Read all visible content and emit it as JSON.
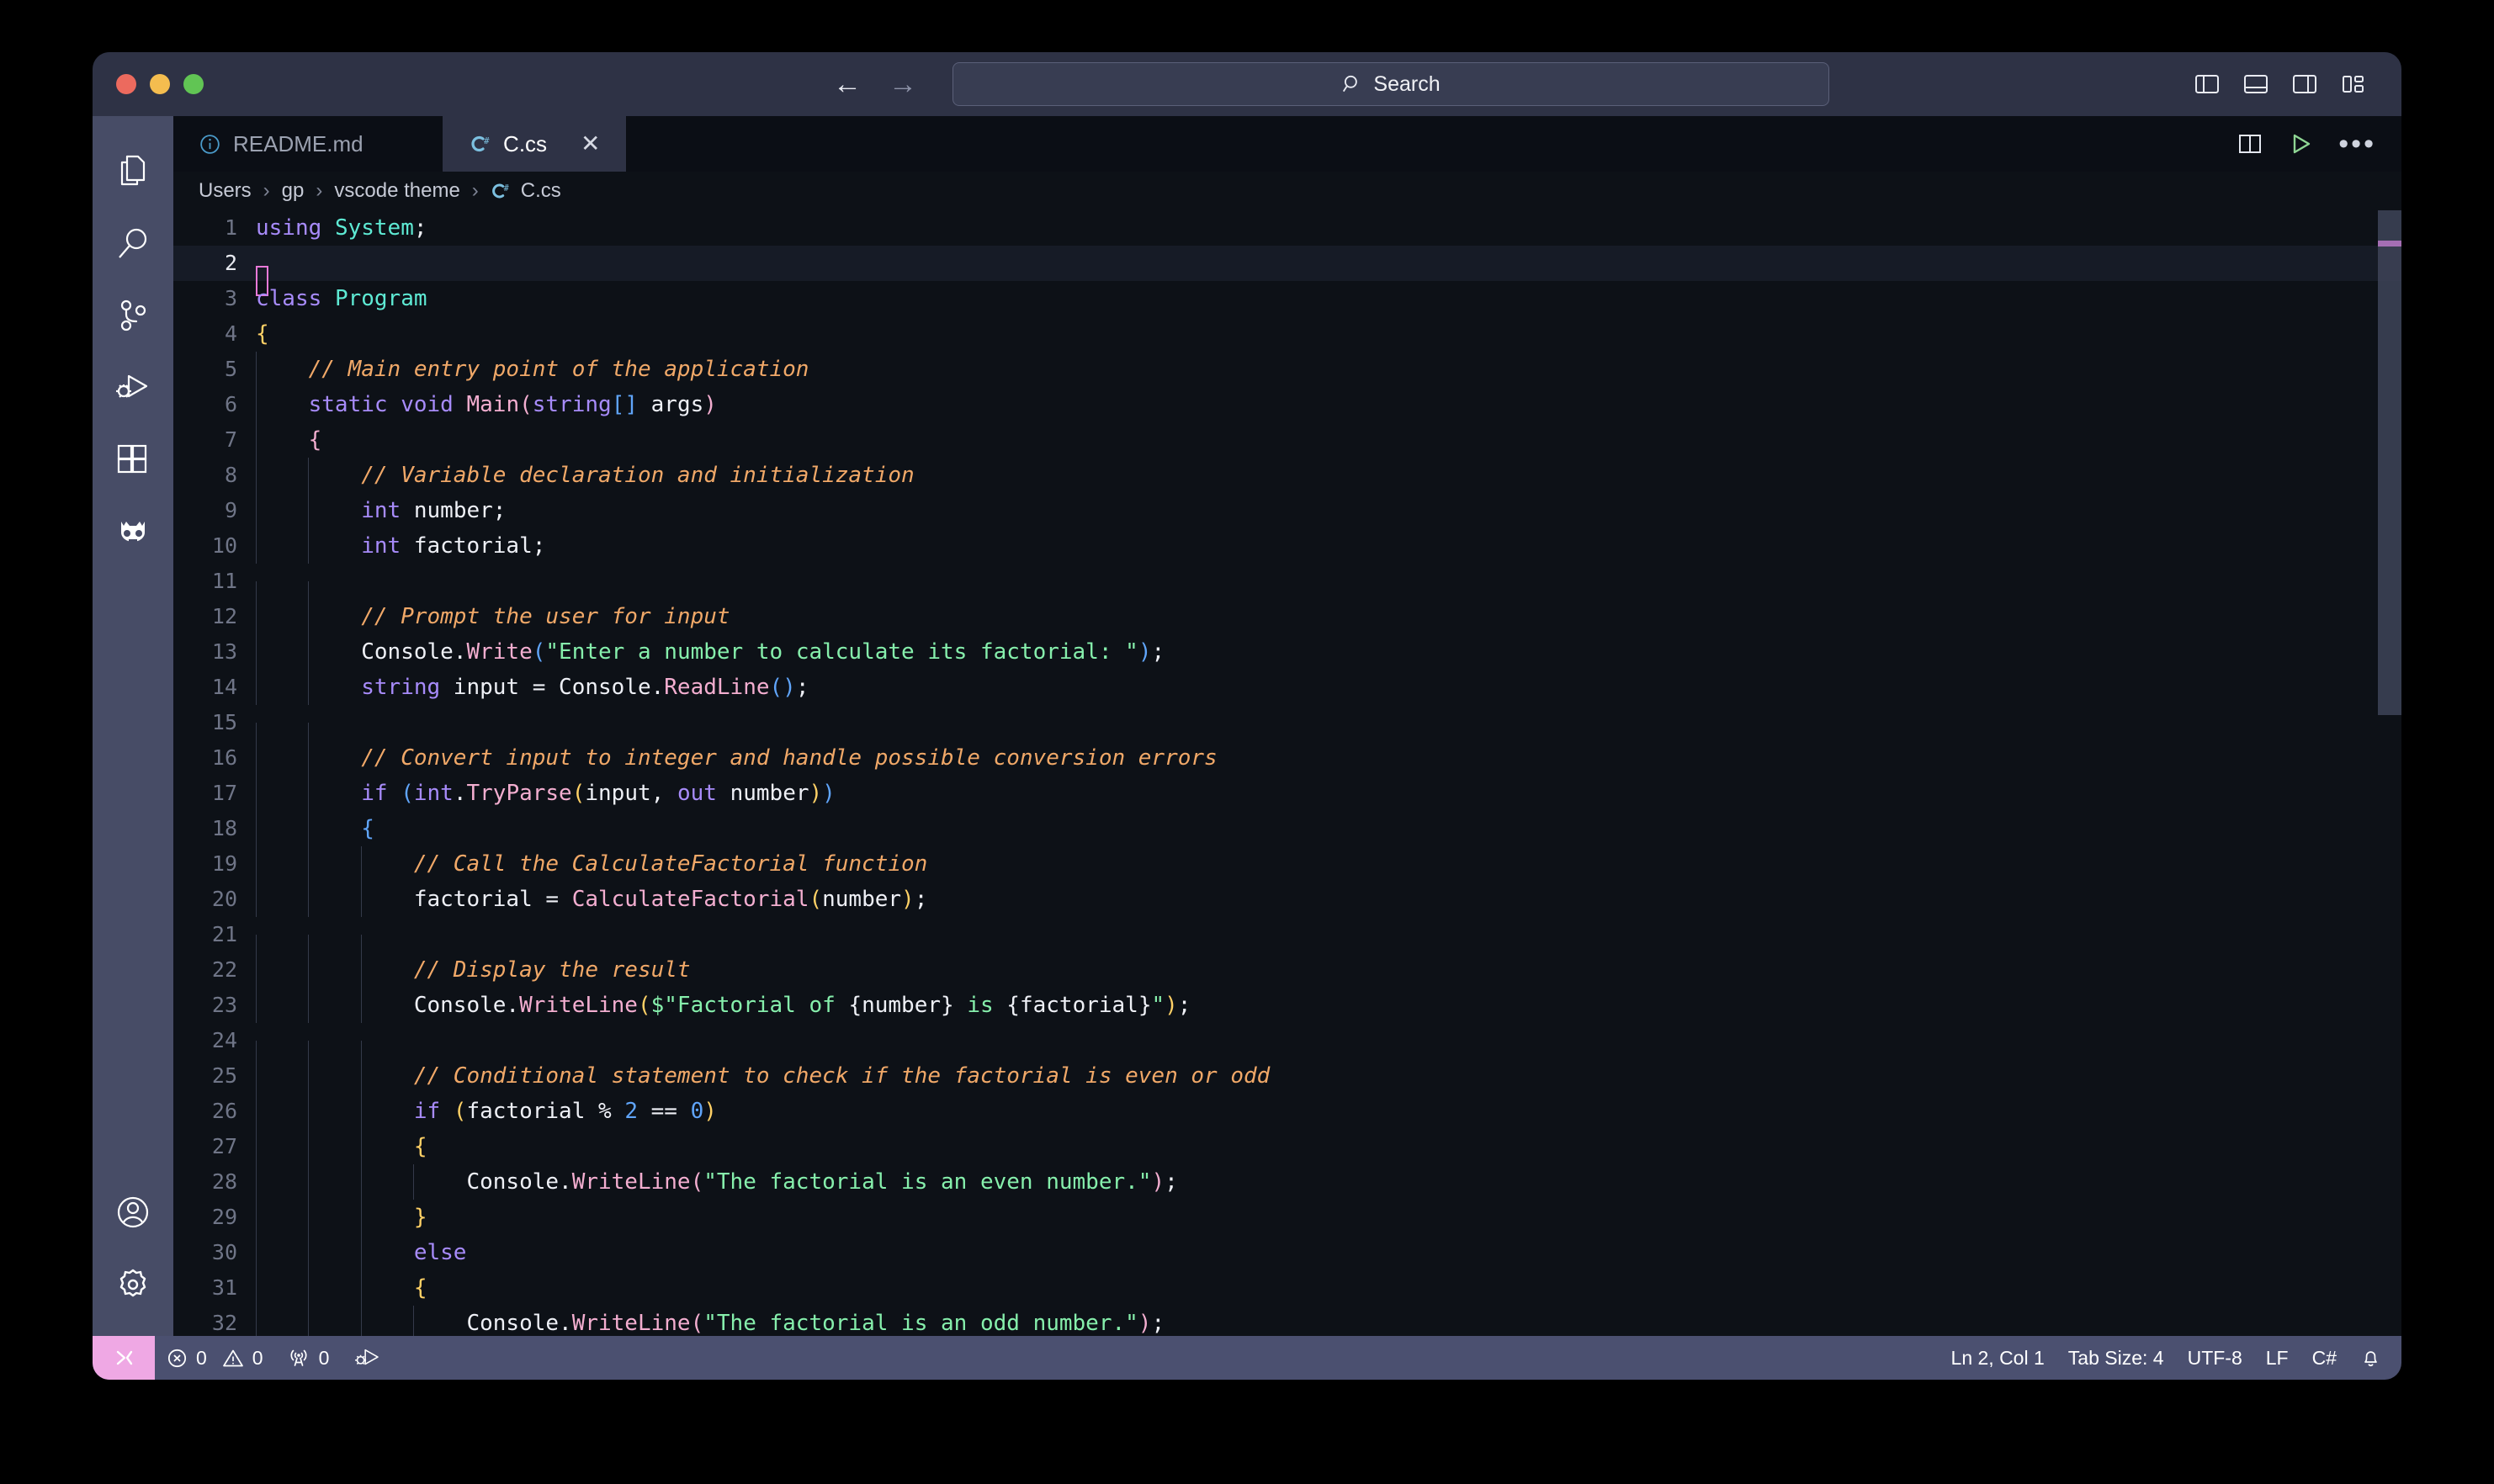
{
  "window": {
    "traffic_lights": [
      "close",
      "minimize",
      "maximize"
    ]
  },
  "titlebar": {
    "back_label": "←",
    "forward_label": "→",
    "search": {
      "icon": "search-icon",
      "label": "Search"
    },
    "layout_icons": [
      "toggle-primary-sidebar-icon",
      "toggle-panel-icon",
      "toggle-secondary-sidebar-icon",
      "customize-layout-icon"
    ]
  },
  "activitybar": {
    "top_items": [
      {
        "name": "explorer",
        "icon": "files-icon"
      },
      {
        "name": "search",
        "icon": "search-icon"
      },
      {
        "name": "source-control",
        "icon": "source-control-icon"
      },
      {
        "name": "run-and-debug",
        "icon": "run-debug-icon"
      },
      {
        "name": "extensions",
        "icon": "extensions-icon"
      },
      {
        "name": "godot-tools",
        "icon": "godot-icon"
      }
    ],
    "bottom_items": [
      {
        "name": "accounts",
        "icon": "account-icon"
      },
      {
        "name": "manage-settings",
        "icon": "gear-icon"
      }
    ]
  },
  "tabs": [
    {
      "label": "README.md",
      "icon": "markdown-info-icon",
      "active": false
    },
    {
      "label": "C.cs",
      "icon": "csharp-icon",
      "active": true,
      "close": "✕"
    }
  ],
  "editor_actions": {
    "split_editor": "split-editor-icon",
    "run_file": "run-play-icon",
    "more_actions": "•••"
  },
  "breadcrumb": {
    "separator": "›",
    "items": [
      {
        "label": "Users"
      },
      {
        "label": "gp"
      },
      {
        "label": "vscode theme"
      },
      {
        "label": "C.cs",
        "icon": "csharp-icon"
      }
    ]
  },
  "editor": {
    "language": "C#",
    "cursor_line": 2,
    "first_visible_line": 1,
    "lines": [
      {
        "n": 1,
        "indent": 0,
        "tokens": [
          {
            "t": "using",
            "c": "k"
          },
          {
            "t": " ",
            "c": "op"
          },
          {
            "t": "System",
            "c": "ty"
          },
          {
            "t": ";",
            "c": "op"
          }
        ]
      },
      {
        "n": 2,
        "indent": 0,
        "cursor": true,
        "tokens": []
      },
      {
        "n": 3,
        "indent": 0,
        "tokens": [
          {
            "t": "class",
            "c": "k"
          },
          {
            "t": " ",
            "c": "op"
          },
          {
            "t": "Program",
            "c": "ty"
          }
        ]
      },
      {
        "n": 4,
        "indent": 0,
        "tokens": [
          {
            "t": "{",
            "c": "b1"
          }
        ]
      },
      {
        "n": 5,
        "indent": 1,
        "tokens": [
          {
            "t": "    ",
            "c": "op"
          },
          {
            "t": "// Main entry point of the application",
            "c": "cm"
          }
        ]
      },
      {
        "n": 6,
        "indent": 1,
        "tokens": [
          {
            "t": "    ",
            "c": "op"
          },
          {
            "t": "static",
            "c": "k"
          },
          {
            "t": " ",
            "c": "op"
          },
          {
            "t": "void",
            "c": "k"
          },
          {
            "t": " ",
            "c": "op"
          },
          {
            "t": "Main",
            "c": "fn"
          },
          {
            "t": "(",
            "c": "b3"
          },
          {
            "t": "string",
            "c": "k"
          },
          {
            "t": "[]",
            "c": "b2"
          },
          {
            "t": " args",
            "c": "id"
          },
          {
            "t": ")",
            "c": "b3"
          }
        ]
      },
      {
        "n": 7,
        "indent": 1,
        "tokens": [
          {
            "t": "    ",
            "c": "op"
          },
          {
            "t": "{",
            "c": "b3"
          }
        ]
      },
      {
        "n": 8,
        "indent": 2,
        "tokens": [
          {
            "t": "        ",
            "c": "op"
          },
          {
            "t": "// Variable declaration and initialization",
            "c": "cm"
          }
        ]
      },
      {
        "n": 9,
        "indent": 2,
        "tokens": [
          {
            "t": "        ",
            "c": "op"
          },
          {
            "t": "int",
            "c": "k"
          },
          {
            "t": " number;",
            "c": "id"
          }
        ]
      },
      {
        "n": 10,
        "indent": 2,
        "tokens": [
          {
            "t": "        ",
            "c": "op"
          },
          {
            "t": "int",
            "c": "k"
          },
          {
            "t": " factorial;",
            "c": "id"
          }
        ]
      },
      {
        "n": 11,
        "indent": 2,
        "tokens": []
      },
      {
        "n": 12,
        "indent": 2,
        "tokens": [
          {
            "t": "        ",
            "c": "op"
          },
          {
            "t": "// Prompt the user for input",
            "c": "cm"
          }
        ]
      },
      {
        "n": 13,
        "indent": 2,
        "tokens": [
          {
            "t": "        ",
            "c": "op"
          },
          {
            "t": "Console",
            "c": "id"
          },
          {
            "t": ".",
            "c": "op"
          },
          {
            "t": "Write",
            "c": "fn"
          },
          {
            "t": "(",
            "c": "b2"
          },
          {
            "t": "\"Enter a number to calculate its factorial: \"",
            "c": "st"
          },
          {
            "t": ")",
            "c": "b2"
          },
          {
            "t": ";",
            "c": "op"
          }
        ]
      },
      {
        "n": 14,
        "indent": 2,
        "tokens": [
          {
            "t": "        ",
            "c": "op"
          },
          {
            "t": "string",
            "c": "k"
          },
          {
            "t": " input = ",
            "c": "id"
          },
          {
            "t": "Console",
            "c": "id"
          },
          {
            "t": ".",
            "c": "op"
          },
          {
            "t": "ReadLine",
            "c": "fn"
          },
          {
            "t": "()",
            "c": "b2"
          },
          {
            "t": ";",
            "c": "op"
          }
        ]
      },
      {
        "n": 15,
        "indent": 2,
        "tokens": []
      },
      {
        "n": 16,
        "indent": 2,
        "tokens": [
          {
            "t": "        ",
            "c": "op"
          },
          {
            "t": "// Convert input to integer and handle possible conversion errors",
            "c": "cm"
          }
        ]
      },
      {
        "n": 17,
        "indent": 2,
        "tokens": [
          {
            "t": "        ",
            "c": "op"
          },
          {
            "t": "if",
            "c": "k"
          },
          {
            "t": " ",
            "c": "op"
          },
          {
            "t": "(",
            "c": "b2"
          },
          {
            "t": "int",
            "c": "k"
          },
          {
            "t": ".",
            "c": "op"
          },
          {
            "t": "TryParse",
            "c": "fn"
          },
          {
            "t": "(",
            "c": "b1"
          },
          {
            "t": "input, ",
            "c": "id"
          },
          {
            "t": "out",
            "c": "k"
          },
          {
            "t": " number",
            "c": "id"
          },
          {
            "t": ")",
            "c": "b1"
          },
          {
            "t": ")",
            "c": "b2"
          }
        ]
      },
      {
        "n": 18,
        "indent": 2,
        "tokens": [
          {
            "t": "        ",
            "c": "op"
          },
          {
            "t": "{",
            "c": "b2"
          }
        ]
      },
      {
        "n": 19,
        "indent": 3,
        "tokens": [
          {
            "t": "            ",
            "c": "op"
          },
          {
            "t": "// Call the CalculateFactorial function",
            "c": "cm"
          }
        ]
      },
      {
        "n": 20,
        "indent": 3,
        "tokens": [
          {
            "t": "            ",
            "c": "op"
          },
          {
            "t": "factorial = ",
            "c": "id"
          },
          {
            "t": "CalculateFactorial",
            "c": "fn"
          },
          {
            "t": "(",
            "c": "b1"
          },
          {
            "t": "number",
            "c": "id"
          },
          {
            "t": ")",
            "c": "b1"
          },
          {
            "t": ";",
            "c": "op"
          }
        ]
      },
      {
        "n": 21,
        "indent": 3,
        "tokens": []
      },
      {
        "n": 22,
        "indent": 3,
        "tokens": [
          {
            "t": "            ",
            "c": "op"
          },
          {
            "t": "// Display the result",
            "c": "cm"
          }
        ]
      },
      {
        "n": 23,
        "indent": 3,
        "tokens": [
          {
            "t": "            ",
            "c": "op"
          },
          {
            "t": "Console",
            "c": "id"
          },
          {
            "t": ".",
            "c": "op"
          },
          {
            "t": "WriteLine",
            "c": "fn"
          },
          {
            "t": "(",
            "c": "b1"
          },
          {
            "t": "$",
            "c": "st"
          },
          {
            "t": "\"Factorial of ",
            "c": "st"
          },
          {
            "t": "{number}",
            "c": "id"
          },
          {
            "t": " is ",
            "c": "st"
          },
          {
            "t": "{factorial}",
            "c": "id"
          },
          {
            "t": "\"",
            "c": "st"
          },
          {
            "t": ")",
            "c": "b1"
          },
          {
            "t": ";",
            "c": "op"
          }
        ]
      },
      {
        "n": 24,
        "indent": 3,
        "tokens": []
      },
      {
        "n": 25,
        "indent": 3,
        "tokens": [
          {
            "t": "            ",
            "c": "op"
          },
          {
            "t": "// Conditional statement to check if the factorial is even or odd",
            "c": "cm"
          }
        ]
      },
      {
        "n": 26,
        "indent": 3,
        "tokens": [
          {
            "t": "            ",
            "c": "op"
          },
          {
            "t": "if",
            "c": "k"
          },
          {
            "t": " ",
            "c": "op"
          },
          {
            "t": "(",
            "c": "b1"
          },
          {
            "t": "factorial ",
            "c": "id"
          },
          {
            "t": "%",
            "c": "op"
          },
          {
            "t": " ",
            "c": "op"
          },
          {
            "t": "2",
            "c": "nu"
          },
          {
            "t": " == ",
            "c": "op"
          },
          {
            "t": "0",
            "c": "nu"
          },
          {
            "t": ")",
            "c": "b1"
          }
        ]
      },
      {
        "n": 27,
        "indent": 3,
        "tokens": [
          {
            "t": "            ",
            "c": "op"
          },
          {
            "t": "{",
            "c": "b1"
          }
        ]
      },
      {
        "n": 28,
        "indent": 4,
        "tokens": [
          {
            "t": "                ",
            "c": "op"
          },
          {
            "t": "Console",
            "c": "id"
          },
          {
            "t": ".",
            "c": "op"
          },
          {
            "t": "WriteLine",
            "c": "fn"
          },
          {
            "t": "(",
            "c": "b3"
          },
          {
            "t": "\"The factorial is an even number.\"",
            "c": "st"
          },
          {
            "t": ")",
            "c": "b3"
          },
          {
            "t": ";",
            "c": "op"
          }
        ]
      },
      {
        "n": 29,
        "indent": 3,
        "tokens": [
          {
            "t": "            ",
            "c": "op"
          },
          {
            "t": "}",
            "c": "b1"
          }
        ]
      },
      {
        "n": 30,
        "indent": 3,
        "tokens": [
          {
            "t": "            ",
            "c": "op"
          },
          {
            "t": "else",
            "c": "k"
          }
        ]
      },
      {
        "n": 31,
        "indent": 3,
        "tokens": [
          {
            "t": "            ",
            "c": "op"
          },
          {
            "t": "{",
            "c": "b1"
          }
        ]
      },
      {
        "n": 32,
        "indent": 4,
        "tokens": [
          {
            "t": "                ",
            "c": "op"
          },
          {
            "t": "Console",
            "c": "id"
          },
          {
            "t": ".",
            "c": "op"
          },
          {
            "t": "WriteLine",
            "c": "fn"
          },
          {
            "t": "(",
            "c": "b3"
          },
          {
            "t": "\"The factorial is an odd number.\"",
            "c": "st"
          },
          {
            "t": ")",
            "c": "b3"
          },
          {
            "t": ";",
            "c": "op"
          }
        ]
      }
    ]
  },
  "statusbar": {
    "remote_icon": "remote-window-icon",
    "left_items": [
      {
        "name": "problems",
        "error_icon": "error-circle-icon",
        "error_count": "0",
        "warning_icon": "warning-triangle-icon",
        "warning_count": "0"
      },
      {
        "name": "ports",
        "icon": "radio-tower-icon",
        "count": "0"
      },
      {
        "name": "debug",
        "icon": "run-debug-icon"
      }
    ],
    "right_items": [
      {
        "name": "cursor-position",
        "label": "Ln 2, Col 1"
      },
      {
        "name": "tab-size",
        "label": "Tab Size: 4"
      },
      {
        "name": "encoding",
        "label": "UTF-8"
      },
      {
        "name": "eol",
        "label": "LF"
      },
      {
        "name": "language-mode",
        "label": "C#"
      },
      {
        "name": "notifications",
        "icon": "bell-icon"
      }
    ]
  },
  "colors": {
    "titlebar_bg": "#2e3245",
    "activitybar_bg": "#474c66",
    "editor_bg": "#0d1117",
    "statusbar_bg": "#4b5070",
    "remote_accent": "#efa8e4",
    "cursor": "#e879d8",
    "keyword": "#a78bfa",
    "type": "#5eead4",
    "comment": "#f0a868",
    "string": "#86efac",
    "function": "#f3aed0",
    "number": "#60a5fa",
    "run_button": "#8fd694"
  }
}
